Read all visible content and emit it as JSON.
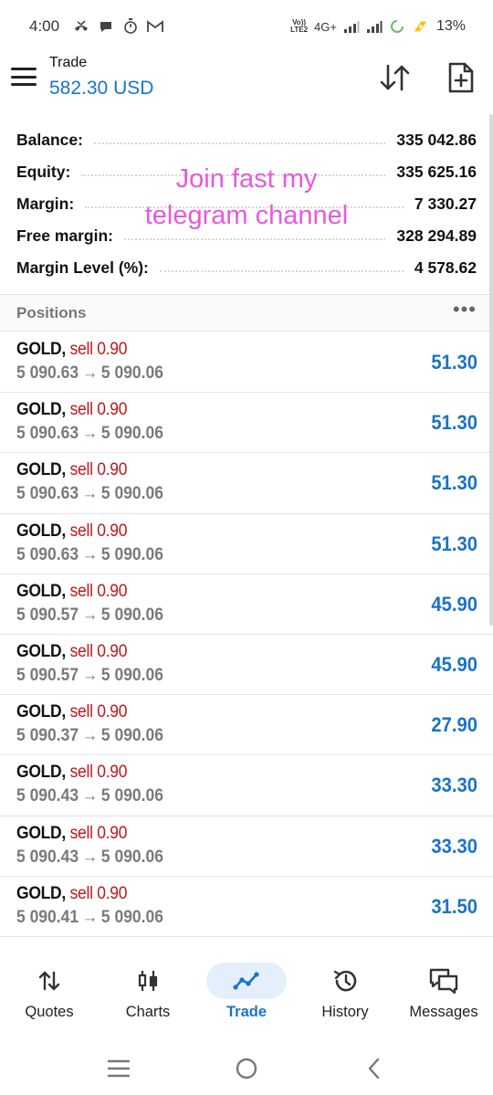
{
  "status_bar": {
    "time": "4:00",
    "network_top": "Vo))",
    "network_bottom": "LTE2",
    "network_type": "4G+",
    "battery_percent": "13%"
  },
  "header": {
    "title": "Trade",
    "balance": "582.30 USD"
  },
  "account_summary": [
    {
      "label": "Balance:",
      "value": "335 042.86"
    },
    {
      "label": "Equity:",
      "value": "335 625.16"
    },
    {
      "label": "Margin:",
      "value": "7 330.27"
    },
    {
      "label": "Free margin:",
      "value": "328 294.89"
    },
    {
      "label": "Margin Level (%):",
      "value": "4 578.62"
    }
  ],
  "watermark_text": {
    "line1": "Join fast my",
    "line2": "telegram channel"
  },
  "positions": {
    "title": "Positions",
    "more": "•••",
    "items": [
      {
        "symbol": "GOLD",
        "side": "sell 0.90",
        "open_price": "5 090.63",
        "current_price": "5 090.06",
        "profit": "51.30"
      },
      {
        "symbol": "GOLD",
        "side": "sell 0.90",
        "open_price": "5 090.63",
        "current_price": "5 090.06",
        "profit": "51.30"
      },
      {
        "symbol": "GOLD",
        "side": "sell 0.90",
        "open_price": "5 090.63",
        "current_price": "5 090.06",
        "profit": "51.30"
      },
      {
        "symbol": "GOLD",
        "side": "sell 0.90",
        "open_price": "5 090.63",
        "current_price": "5 090.06",
        "profit": "51.30"
      },
      {
        "symbol": "GOLD",
        "side": "sell 0.90",
        "open_price": "5 090.57",
        "current_price": "5 090.06",
        "profit": "45.90"
      },
      {
        "symbol": "GOLD",
        "side": "sell 0.90",
        "open_price": "5 090.57",
        "current_price": "5 090.06",
        "profit": "45.90"
      },
      {
        "symbol": "GOLD",
        "side": "sell 0.90",
        "open_price": "5 090.37",
        "current_price": "5 090.06",
        "profit": "27.90"
      },
      {
        "symbol": "GOLD",
        "side": "sell 0.90",
        "open_price": "5 090.43",
        "current_price": "5 090.06",
        "profit": "33.30"
      },
      {
        "symbol": "GOLD",
        "side": "sell 0.90",
        "open_price": "5 090.43",
        "current_price": "5 090.06",
        "profit": "33.30"
      },
      {
        "symbol": "GOLD",
        "side": "sell 0.90",
        "open_price": "5 090.41",
        "current_price": "5 090.06",
        "profit": "31.50"
      }
    ]
  },
  "bottom_nav": [
    {
      "label": "Quotes",
      "icon": "quotes-icon",
      "active": false
    },
    {
      "label": "Charts",
      "icon": "charts-icon",
      "active": false
    },
    {
      "label": "Trade",
      "icon": "trade-icon",
      "active": true
    },
    {
      "label": "History",
      "icon": "history-icon",
      "active": false
    },
    {
      "label": "Messages",
      "icon": "messages-icon",
      "active": false
    }
  ],
  "colors": {
    "accent_blue": "#1a73c9",
    "sell_red": "#c0161a",
    "watermark_pink": "#e858e0",
    "active_nav_bg": "#e4effb"
  }
}
